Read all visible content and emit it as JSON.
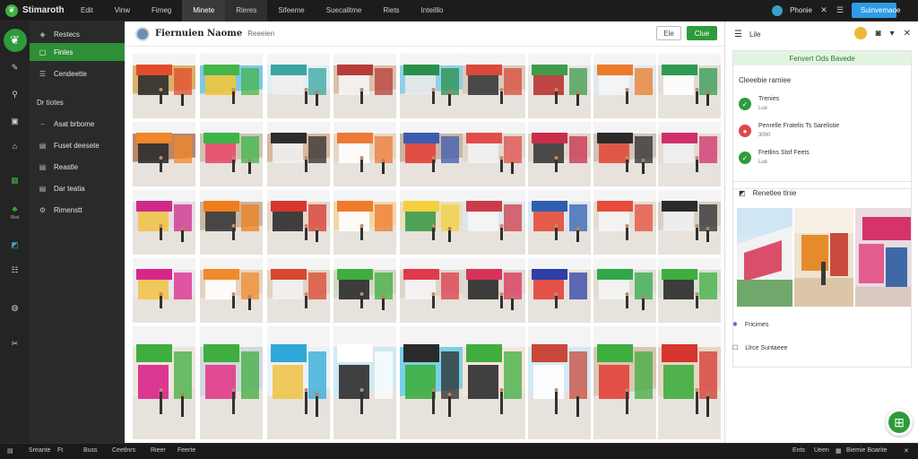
{
  "app": {
    "name": "Stimaroth"
  },
  "topnav": {
    "tabs": [
      "Edit",
      "Vinw",
      "Fimeg",
      "Minete",
      "Rleres",
      "Sifeeme",
      "Suecalltme",
      "Riets",
      "Inteilllo"
    ]
  },
  "top_right": {
    "user": "Phonie",
    "action_button": "Suinvemaoe"
  },
  "rail": {
    "items": [
      {
        "icon": "home-icon",
        "label": ""
      },
      {
        "icon": "pen-icon",
        "label": ""
      },
      {
        "icon": "link-icon",
        "label": ""
      },
      {
        "icon": "box-icon",
        "label": ""
      },
      {
        "icon": "lock-icon",
        "label": ""
      },
      {
        "icon": "grid-icon",
        "label": ""
      },
      {
        "icon": "tree-icon",
        "label": "Rbsl"
      },
      {
        "icon": "image-icon",
        "label": ""
      },
      {
        "icon": "sliders-icon",
        "label": ""
      },
      {
        "icon": "globe-icon",
        "label": ""
      },
      {
        "icon": "wrench-icon",
        "label": ""
      }
    ]
  },
  "sidebar": {
    "items": [
      {
        "label": "Restecs",
        "icon": "layers-icon"
      },
      {
        "label": "Finles",
        "icon": "square-icon"
      },
      {
        "label": "Cendeette",
        "icon": "sliders-icon"
      }
    ],
    "section_title": "Dr tiotes",
    "sub_items": [
      {
        "label": "Asat brbome",
        "icon": "minus-icon"
      },
      {
        "label": "Fuset deesete",
        "icon": "doc-icon"
      },
      {
        "label": "Reastle",
        "icon": "doc-icon"
      },
      {
        "label": "Dar teatia",
        "icon": "doc-icon"
      },
      {
        "label": "Rimenstt",
        "icon": "gear-icon"
      }
    ]
  },
  "main": {
    "title": "Fiernuien Naome",
    "subtitle": "Reeeien",
    "btn_secondary": "Ele",
    "btn_primary": "Clue"
  },
  "right_panel": {
    "header_label": "Lile",
    "banner": "Fenvert Ods Bavede",
    "subtitle": "Cleeebie ramiee",
    "rows": [
      {
        "title": "Trenies",
        "meta": "Lue",
        "color": "#2e9b3a"
      },
      {
        "title": "Penrelle Fratelis Ts Sarelistie",
        "meta": "3000",
        "color": "#e0474c"
      },
      {
        "title": "Fretlins Stof Feets",
        "meta": "Lue",
        "color": "#2e9b3a"
      }
    ],
    "gallery_title": "Renetlee tlnie",
    "list": [
      {
        "icon": "users-icon",
        "label": "Fricimes"
      },
      {
        "icon": "checkbox-icon",
        "label": "Llrce Suntaeee"
      }
    ]
  },
  "statusbar": {
    "left": [
      "Sreante",
      "Ft",
      "Buss",
      "Ceetlnrs",
      "Rieer",
      "Feerte"
    ],
    "right": [
      "Ents",
      "Ueen",
      "Biemie Boarite"
    ]
  },
  "colors": {
    "accent": "#2e9b3a",
    "blue": "#2f9be8"
  }
}
